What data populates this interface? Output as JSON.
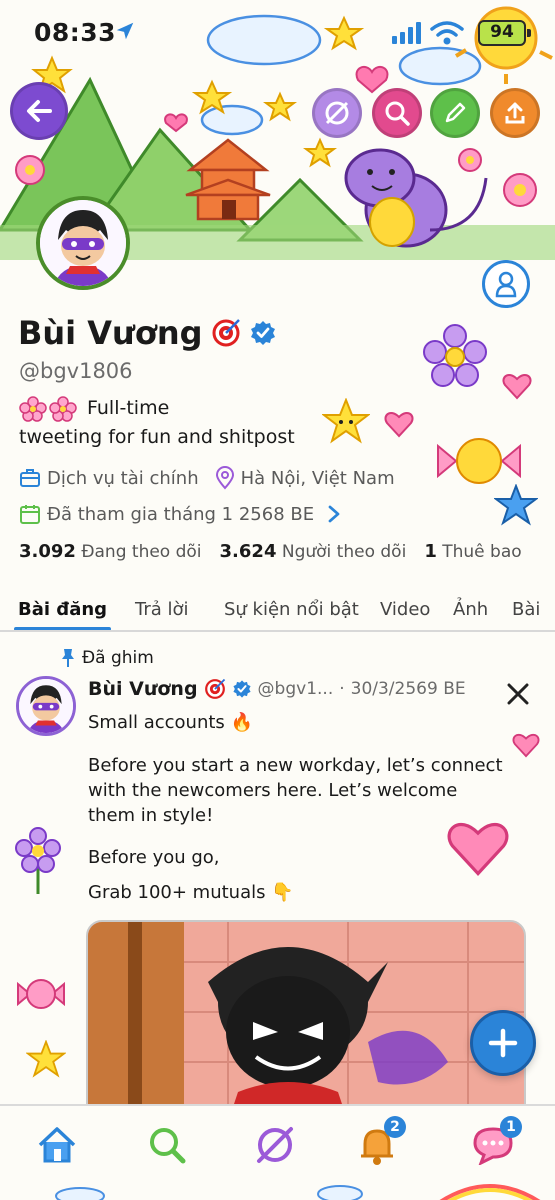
{
  "status_bar": {
    "time": "08:33",
    "battery": "94"
  },
  "profile": {
    "name": "Bùi Vương",
    "handle": "@bgv1806",
    "bio_line1": "Full-time",
    "bio_line2": "tweeting for fun and shitpost",
    "category": "Dịch vụ tài chính",
    "location": "Hà Nội, Việt Nam",
    "joined": "Đã tham gia tháng 1 2568 BE",
    "following_count": "3.092",
    "following_label": "Đang theo dõi",
    "followers_count": "3.624",
    "followers_label": "Người theo dõi",
    "subscriptions_count": "1",
    "subscriptions_label": "Thuê bao"
  },
  "tabs": [
    "Bài đăng",
    "Trả lời",
    "Sự kiện nổi bật",
    "Video",
    "Ảnh",
    "Bài"
  ],
  "tweet": {
    "pinned_label": "Đã ghim",
    "author": "Bùi Vương",
    "handle_truncated": "@bgv1...",
    "date": "30/3/2569 BE",
    "line1": "Small accounts 🔥",
    "para1": "Before you start a new workday, let’s connect with the newcomers here. Let’s welcome them in style!",
    "para2": "Before you go,",
    "para3": "Grab 100+ mutuals 👇"
  },
  "nav": {
    "notifications_badge": "2",
    "messages_badge": "1"
  },
  "colors": {
    "accent": "#2b84d8",
    "verified": "#2b84d8"
  }
}
